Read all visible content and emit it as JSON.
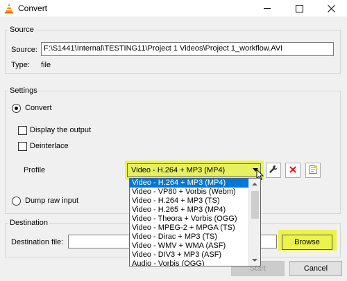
{
  "window": {
    "title": "Convert",
    "icons": {
      "app": "vlc-cone-icon",
      "minimize": "minimize-icon",
      "maximize": "maximize-icon",
      "close": "close-icon"
    }
  },
  "source": {
    "group_label": "Source",
    "source_label": "Source:",
    "source_value": "F:\\S1441\\Internal\\TESTING11\\Project 1 Videos\\Project 1_workflow.AVI",
    "type_label": "Type:",
    "type_value": "file"
  },
  "settings": {
    "group_label": "Settings",
    "convert_label": "Convert",
    "convert_selected": true,
    "display_output_label": "Display the output",
    "deinterlace_label": "Deinterlace",
    "profile_label": "Profile",
    "profile_selected": "Video - H.264 + MP3 (MP4)",
    "dump_raw_label": "Dump raw input"
  },
  "profile_options": [
    "Video - H.264 + MP3 (MP4)",
    "Video - VP80 + Vorbis (Webm)",
    "Video - H.264 + MP3 (TS)",
    "Video - H.265 + MP3 (MP4)",
    "Video - Theora + Vorbis (OGG)",
    "Video - MPEG-2 + MPGA (TS)",
    "Video - Dirac + MP3 (TS)",
    "Video - WMV + WMA (ASF)",
    "Video - DIV3 + MP3 (ASF)",
    "Audio - Vorbis (OGG)"
  ],
  "profile_icons": {
    "edit": "wrench-icon",
    "delete": "delete-x-icon",
    "new": "new-profile-icon"
  },
  "destination": {
    "group_label": "Destination",
    "file_label": "Destination file:",
    "file_value": "",
    "browse_label": "Browse"
  },
  "footer": {
    "start_label": "Start",
    "cancel_label": "Cancel"
  },
  "colors": {
    "highlight": "#ecf34a",
    "selection": "#0078d7",
    "delete_red": "#e81123"
  }
}
